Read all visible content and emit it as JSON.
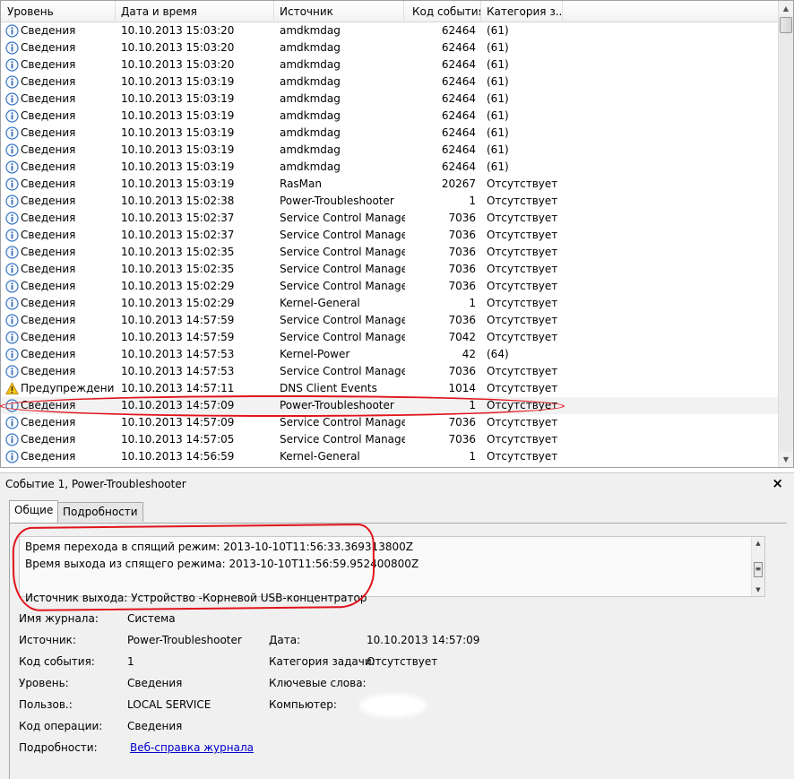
{
  "colors": {
    "annotation": "#e1141c",
    "link": "#0000cc",
    "warning": "#f0b400",
    "info": "#3a78c4"
  },
  "columns": [
    "Уровень",
    "Дата и время",
    "Источник",
    "Код события",
    "Категория з..."
  ],
  "rows": [
    {
      "icon": "info-icon",
      "level": "Сведения",
      "date": "10.10.2013 15:03:20",
      "source": "amdkmdag",
      "code": "62464",
      "category": "(61)"
    },
    {
      "icon": "info-icon",
      "level": "Сведения",
      "date": "10.10.2013 15:03:20",
      "source": "amdkmdag",
      "code": "62464",
      "category": "(61)"
    },
    {
      "icon": "info-icon",
      "level": "Сведения",
      "date": "10.10.2013 15:03:20",
      "source": "amdkmdag",
      "code": "62464",
      "category": "(61)"
    },
    {
      "icon": "info-icon",
      "level": "Сведения",
      "date": "10.10.2013 15:03:19",
      "source": "amdkmdag",
      "code": "62464",
      "category": "(61)"
    },
    {
      "icon": "info-icon",
      "level": "Сведения",
      "date": "10.10.2013 15:03:19",
      "source": "amdkmdag",
      "code": "62464",
      "category": "(61)"
    },
    {
      "icon": "info-icon",
      "level": "Сведения",
      "date": "10.10.2013 15:03:19",
      "source": "amdkmdag",
      "code": "62464",
      "category": "(61)"
    },
    {
      "icon": "info-icon",
      "level": "Сведения",
      "date": "10.10.2013 15:03:19",
      "source": "amdkmdag",
      "code": "62464",
      "category": "(61)"
    },
    {
      "icon": "info-icon",
      "level": "Сведения",
      "date": "10.10.2013 15:03:19",
      "source": "amdkmdag",
      "code": "62464",
      "category": "(61)"
    },
    {
      "icon": "info-icon",
      "level": "Сведения",
      "date": "10.10.2013 15:03:19",
      "source": "amdkmdag",
      "code": "62464",
      "category": "(61)"
    },
    {
      "icon": "info-icon",
      "level": "Сведения",
      "date": "10.10.2013 15:03:19",
      "source": "RasMan",
      "code": "20267",
      "category": "Отсутствует"
    },
    {
      "icon": "info-icon",
      "level": "Сведения",
      "date": "10.10.2013 15:02:38",
      "source": "Power-Troubleshooter",
      "code": "1",
      "category": "Отсутствует"
    },
    {
      "icon": "info-icon",
      "level": "Сведения",
      "date": "10.10.2013 15:02:37",
      "source": "Service Control Manager",
      "code": "7036",
      "category": "Отсутствует"
    },
    {
      "icon": "info-icon",
      "level": "Сведения",
      "date": "10.10.2013 15:02:37",
      "source": "Service Control Manager",
      "code": "7036",
      "category": "Отсутствует"
    },
    {
      "icon": "info-icon",
      "level": "Сведения",
      "date": "10.10.2013 15:02:35",
      "source": "Service Control Manager",
      "code": "7036",
      "category": "Отсутствует"
    },
    {
      "icon": "info-icon",
      "level": "Сведения",
      "date": "10.10.2013 15:02:35",
      "source": "Service Control Manager",
      "code": "7036",
      "category": "Отсутствует"
    },
    {
      "icon": "info-icon",
      "level": "Сведения",
      "date": "10.10.2013 15:02:29",
      "source": "Service Control Manager",
      "code": "7036",
      "category": "Отсутствует"
    },
    {
      "icon": "info-icon",
      "level": "Сведения",
      "date": "10.10.2013 15:02:29",
      "source": "Kernel-General",
      "code": "1",
      "category": "Отсутствует"
    },
    {
      "icon": "info-icon",
      "level": "Сведения",
      "date": "10.10.2013 14:57:59",
      "source": "Service Control Manager",
      "code": "7036",
      "category": "Отсутствует"
    },
    {
      "icon": "info-icon",
      "level": "Сведения",
      "date": "10.10.2013 14:57:59",
      "source": "Service Control Manager",
      "code": "7042",
      "category": "Отсутствует"
    },
    {
      "icon": "info-icon",
      "level": "Сведения",
      "date": "10.10.2013 14:57:53",
      "source": "Kernel-Power",
      "code": "42",
      "category": "(64)"
    },
    {
      "icon": "info-icon",
      "level": "Сведения",
      "date": "10.10.2013 14:57:53",
      "source": "Service Control Manager",
      "code": "7036",
      "category": "Отсутствует"
    },
    {
      "icon": "warning-icon",
      "level": "Предупреждение",
      "date": "10.10.2013 14:57:11",
      "source": "DNS Client Events",
      "code": "1014",
      "category": "Отсутствует"
    },
    {
      "icon": "info-icon",
      "level": "Сведения",
      "date": "10.10.2013 14:57:09",
      "source": "Power-Troubleshooter",
      "code": "1",
      "category": "Отсутствует",
      "selected": true
    },
    {
      "icon": "info-icon",
      "level": "Сведения",
      "date": "10.10.2013 14:57:09",
      "source": "Service Control Manager",
      "code": "7036",
      "category": "Отсутствует"
    },
    {
      "icon": "info-icon",
      "level": "Сведения",
      "date": "10.10.2013 14:57:05",
      "source": "Service Control Manager",
      "code": "7036",
      "category": "Отсутствует"
    },
    {
      "icon": "info-icon",
      "level": "Сведения",
      "date": "10.10.2013 14:56:59",
      "source": "Kernel-General",
      "code": "1",
      "category": "Отсутствует"
    }
  ],
  "detail": {
    "title": "Событие 1, Power-Troubleshooter",
    "close": "×",
    "tabs": [
      "Общие",
      "Подробности"
    ],
    "description": [
      "Время перехода в спящий режим: 2013-10-10T11:56:33.369313800Z",
      "Время выхода из спящего режима: 2013-10-10T11:56:59.952400800Z",
      "",
      "Источник выхода: Устройство -Корневой USB-концентратор"
    ],
    "props": {
      "log_name_label": "Имя журнала:",
      "log_name": "Система",
      "source_label": "Источник:",
      "source": "Power-Troubleshooter",
      "date_label": "Дата:",
      "date": "10.10.2013 14:57:09",
      "event_code_label": "Код события:",
      "event_code": "1",
      "task_category_label": "Категория задачи:",
      "task_category": "Отсутствует",
      "level_label": "Уровень:",
      "level": "Сведения",
      "keywords_label": "Ключевые слова:",
      "user_label": "Пользов.:",
      "user": "LOCAL SERVICE",
      "computer_label": "Компьютер:",
      "opcode_label": "Код операции:",
      "opcode": "Сведения",
      "more_label": "Подробности:",
      "more_link": "Веб-справка журнала"
    }
  }
}
